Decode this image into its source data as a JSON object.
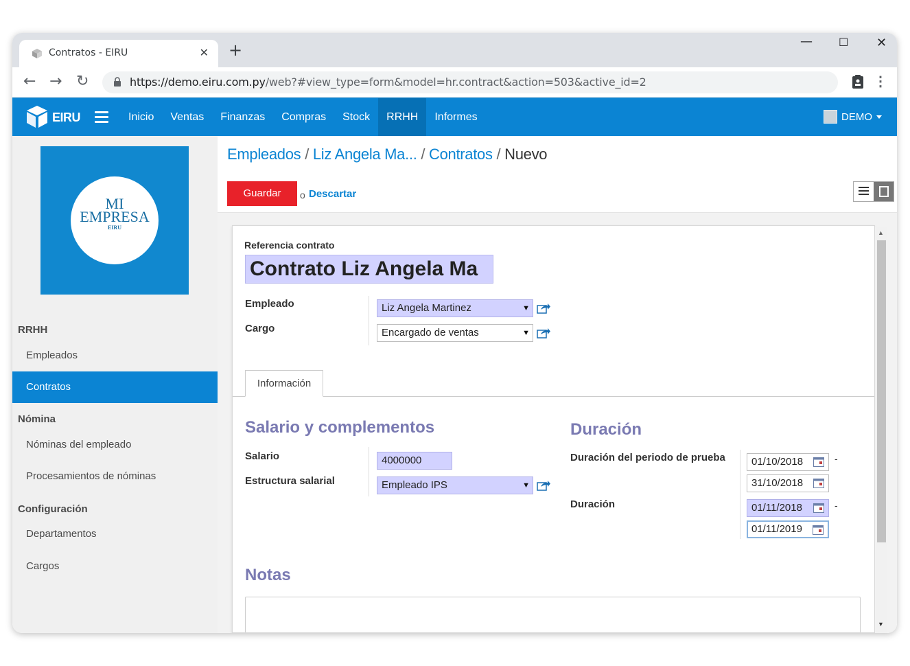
{
  "browser": {
    "tab_title": "Contratos - EIRU",
    "new_tab": "+",
    "url_host": "https://demo.eiru.com.py",
    "url_path": "/web?#view_type=form&model=hr.contract&action=503&active_id=2"
  },
  "appbar": {
    "brand": "EIRU",
    "menu": [
      "Inicio",
      "Ventas",
      "Finanzas",
      "Compras",
      "Stock",
      "RRHH",
      "Informes"
    ],
    "active_menu": "RRHH",
    "user": "DEMO"
  },
  "sidebar": {
    "company_logo": {
      "line1": "MI",
      "line2": "EMPRESA",
      "line3": "EIRU"
    },
    "sections": [
      {
        "header": "RRHH",
        "items": [
          "Empleados",
          "Contratos"
        ]
      },
      {
        "header": "Nómina",
        "items": [
          "Nóminas del empleado",
          "Procesamientos de nóminas"
        ]
      },
      {
        "header": "Configuración",
        "items": [
          "Departamentos",
          "Cargos"
        ]
      }
    ],
    "active_item": "Contratos"
  },
  "breadcrumb": {
    "items": [
      "Empleados",
      "Liz Angela Ma...",
      "Contratos"
    ],
    "current": "Nuevo",
    "separator": "/"
  },
  "actions": {
    "save": "Guardar",
    "or": "o",
    "discard": "Descartar"
  },
  "form": {
    "ref_label": "Referencia contrato",
    "ref_value": "Contrato Liz Angela Ma",
    "employee_label": "Empleado",
    "employee_value": "Liz Angela Martinez",
    "job_label": "Cargo",
    "job_value": "Encargado de ventas",
    "tab": "Información",
    "salary_section": "Salario y complementos",
    "salary_label": "Salario",
    "salary_value": "4000000",
    "structure_label": "Estructura salarial",
    "structure_value": "Empleado IPS",
    "duration_section": "Duración",
    "trial_label": "Duración del periodo de prueba",
    "trial_start": "01/10/2018",
    "trial_end": "31/10/2018",
    "duration_label": "Duración",
    "duration_start": "01/11/2018",
    "duration_end": "01/11/2019",
    "dash": "-",
    "notes_section": "Notas"
  },
  "colors": {
    "appbar": "#0b84d3",
    "save_button": "#e8222a",
    "required_field": "#d2d2ff",
    "section_title": "#7a7ab2"
  }
}
